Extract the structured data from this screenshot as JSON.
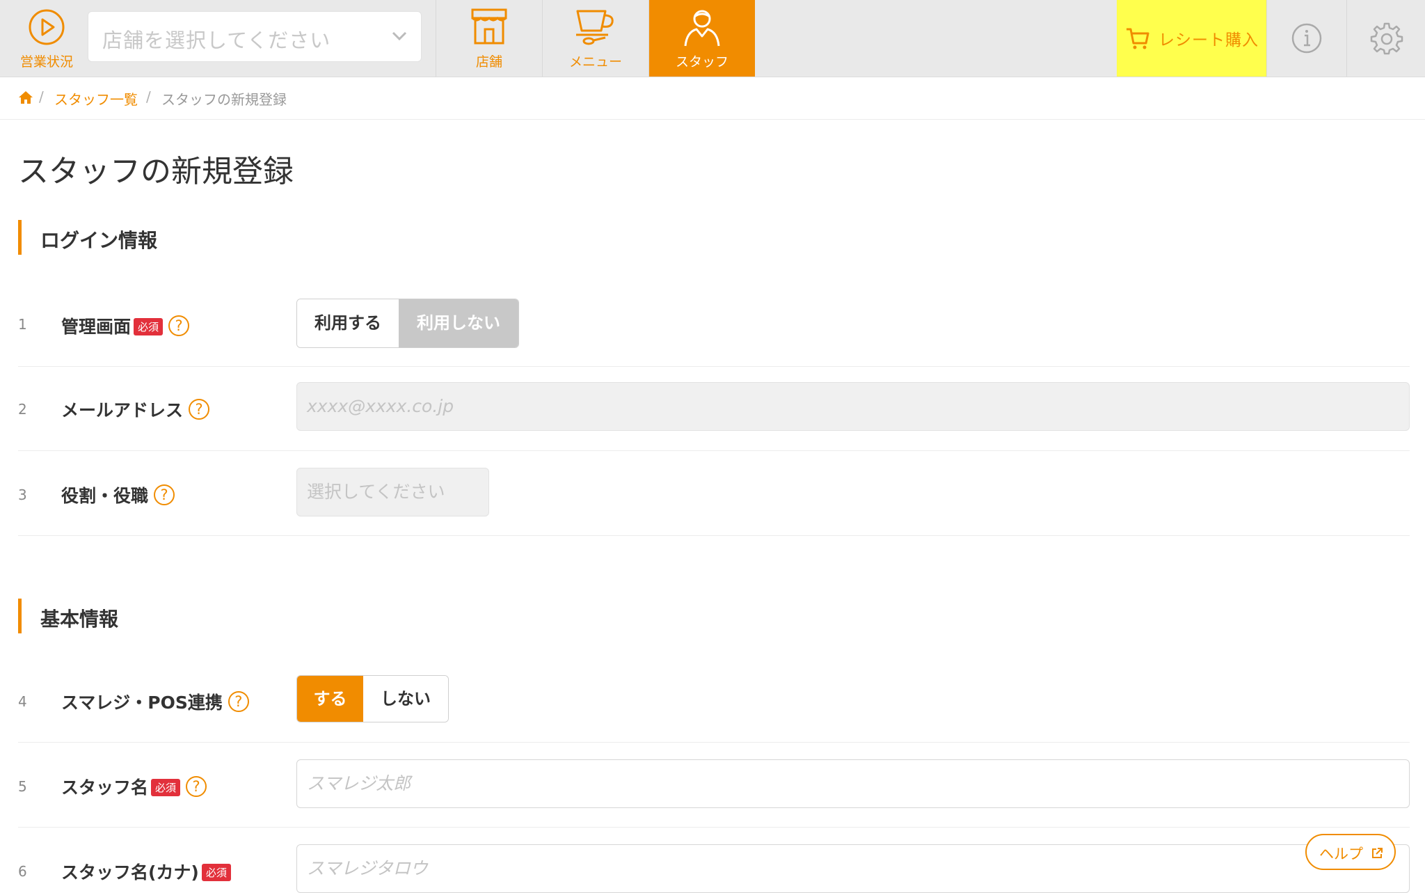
{
  "topbar": {
    "status_label": "営業状況",
    "store_select_placeholder": "店舗を選択してください",
    "tabs": [
      {
        "label": "店舗",
        "icon": "store-icon"
      },
      {
        "label": "メニュー",
        "icon": "cup-icon"
      },
      {
        "label": "スタッフ",
        "icon": "staff-icon",
        "active": true
      }
    ],
    "receipt_label": "レシート購入",
    "accent_color": "#f18c00",
    "receipt_bg": "#ffff4d"
  },
  "breadcrumb": {
    "link": "スタッフ一覧",
    "current": "スタッフの新規登録"
  },
  "page_title": "スタッフの新規登録",
  "sections": {
    "login": "ログイン情報",
    "basic": "基本情報"
  },
  "required_badge": "必須",
  "help_mark": "?",
  "rows": [
    {
      "num": "1",
      "label": "管理画面",
      "options": [
        "利用する",
        "利用しない"
      ],
      "selected": "利用しない"
    },
    {
      "num": "2",
      "label": "メールアドレス",
      "placeholder": "xxxx@xxxx.co.jp"
    },
    {
      "num": "3",
      "label": "役割・役職",
      "placeholder": "選択してください"
    },
    {
      "num": "4",
      "label": "スマレジ・POS連携",
      "options": [
        "する",
        "しない"
      ],
      "selected": "する"
    },
    {
      "num": "5",
      "label": "スタッフ名",
      "placeholder": "スマレジ太郎"
    },
    {
      "num": "6",
      "label": "スタッフ名(カナ)",
      "placeholder": "スマレジタロウ"
    }
  ],
  "help_button": "ヘルプ"
}
